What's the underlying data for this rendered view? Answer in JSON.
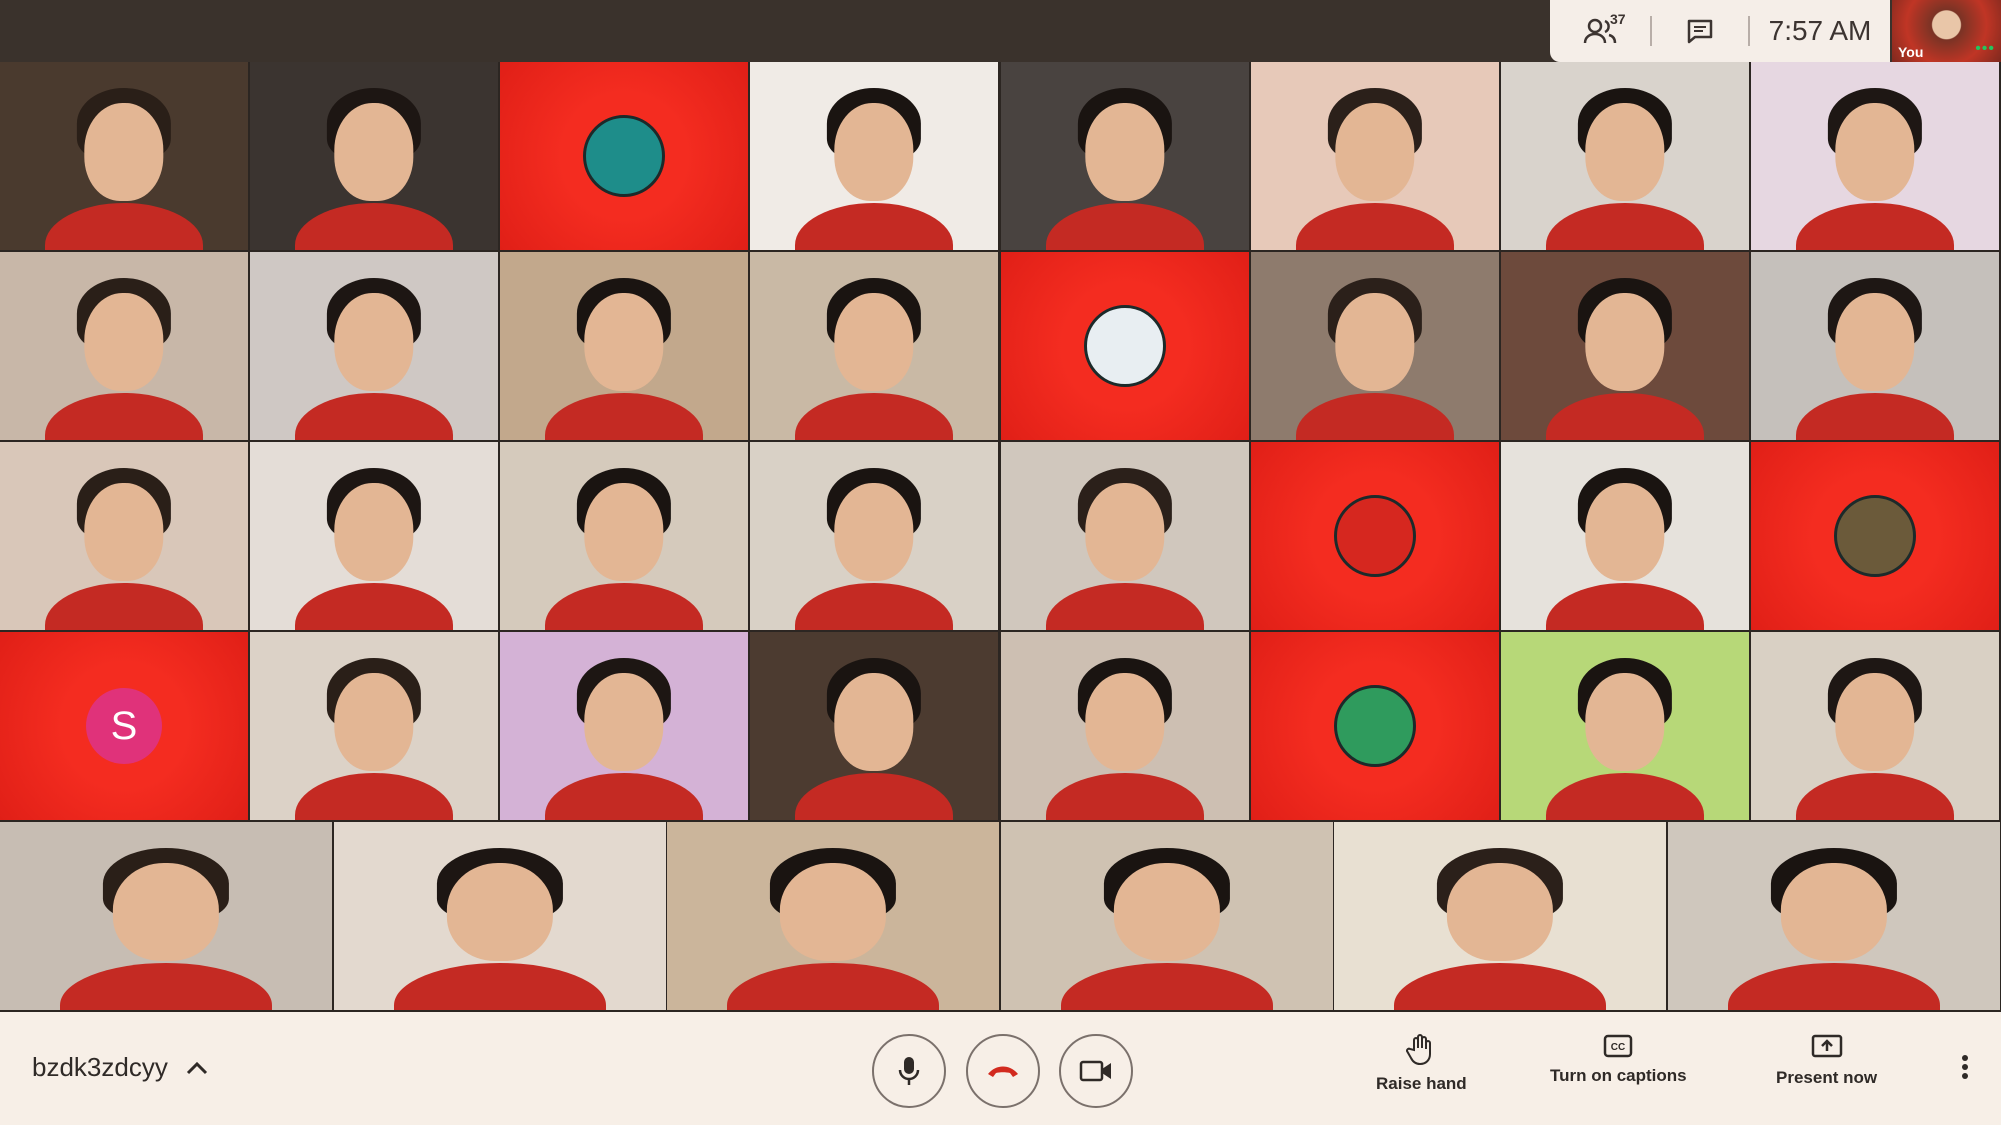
{
  "top": {
    "participants_count": "37",
    "time": "7:57  AM",
    "self_label": "You"
  },
  "tiles_row1": [
    {
      "kind": "person",
      "bg": "#4a3a2e",
      "hair": "#2a1f18"
    },
    {
      "kind": "person",
      "bg": "#3b3430",
      "hair": "#1d1613"
    },
    {
      "kind": "avatar",
      "icon": "squid-avatar",
      "color": "#1e8d8a"
    },
    {
      "kind": "person",
      "bg": "#f0ebe6",
      "hair": "#1a1411"
    },
    {
      "kind": "person",
      "bg": "#494340",
      "hair": "#1a1411"
    },
    {
      "kind": "person",
      "bg": "#e7c9b9",
      "hair": "#2b201a"
    },
    {
      "kind": "person",
      "bg": "#d9d3cc",
      "hair": "#1a1411"
    },
    {
      "kind": "person",
      "bg": "#e6d7e1",
      "hair": "#1e1714"
    }
  ],
  "tiles_row2": [
    {
      "kind": "person",
      "bg": "#c8b7a8",
      "hair": "#2a1f18"
    },
    {
      "kind": "person",
      "bg": "#cfc8c4",
      "hair": "#1d1613"
    },
    {
      "kind": "person",
      "bg": "#c2a88c",
      "hair": "#1a1411"
    },
    {
      "kind": "person",
      "bg": "#c9b9a5",
      "hair": "#1a1411"
    },
    {
      "kind": "avatar",
      "icon": "marshmello-avatar",
      "color": "#e8eef2"
    },
    {
      "kind": "person",
      "bg": "#8e7b6d",
      "hair": "#2b201a"
    },
    {
      "kind": "person",
      "bg": "#6d4a3c",
      "hair": "#1a1411"
    },
    {
      "kind": "person",
      "bg": "#c5c0bb",
      "hair": "#1e1714"
    }
  ],
  "tiles_row3": [
    {
      "kind": "person",
      "bg": "#d9c7b9",
      "hair": "#2a1f18"
    },
    {
      "kind": "person",
      "bg": "#e4ddd7",
      "hair": "#1d1613"
    },
    {
      "kind": "person",
      "bg": "#d5cabc",
      "hair": "#1a1411"
    },
    {
      "kind": "person",
      "bg": "#d9d1c6",
      "hair": "#1a1411"
    },
    {
      "kind": "person",
      "bg": "#d0c7bd",
      "hair": "#2b201a"
    },
    {
      "kind": "avatar",
      "icon": "elmo-avatar",
      "color": "#d6271f"
    },
    {
      "kind": "person",
      "bg": "#e6e2dc",
      "hair": "#1a1411"
    },
    {
      "kind": "avatar",
      "icon": "portrait-avatar",
      "color": "#6b5a3a"
    }
  ],
  "tiles_row4": [
    {
      "kind": "avatar",
      "icon": "letter-avatar",
      "color": "#e0327a",
      "letter": "S"
    },
    {
      "kind": "person",
      "bg": "#dcd2c7",
      "hair": "#2a1f18"
    },
    {
      "kind": "person",
      "bg": "#d4b2d6",
      "hair": "#1d1613"
    },
    {
      "kind": "person",
      "bg": "#4c3b30",
      "hair": "#1a1411"
    },
    {
      "kind": "person",
      "bg": "#cdbfb2",
      "hair": "#1a1411"
    },
    {
      "kind": "avatar",
      "icon": "parrot-avatar",
      "color": "#2f9b5d"
    },
    {
      "kind": "person",
      "bg": "#b7d878",
      "hair": "#1a1411"
    },
    {
      "kind": "person",
      "bg": "#d9d0c4",
      "hair": "#1e1714"
    }
  ],
  "tiles_row5": [
    {
      "kind": "person",
      "bg": "#c7bdb3",
      "hair": "#2a1f18"
    },
    {
      "kind": "person",
      "bg": "#e3d9cf",
      "hair": "#1d1613"
    },
    {
      "kind": "person",
      "bg": "#cbb59b",
      "hair": "#1a1411"
    },
    {
      "kind": "person",
      "bg": "#cfc2b2",
      "hair": "#1a1411"
    },
    {
      "kind": "person",
      "bg": "#e8e0d2",
      "hair": "#2b201a"
    },
    {
      "kind": "person",
      "bg": "#cfc7bd",
      "hair": "#1a1411"
    }
  ],
  "bottom": {
    "meeting_code": "bzdk3zdcyy",
    "raise_hand": "Raise hand",
    "captions": "Turn on captions",
    "present": "Present now"
  },
  "colors": {
    "accent_red": "#f42c20",
    "hangup_red": "#d22a1f",
    "panel_bg": "#f7efe7"
  }
}
